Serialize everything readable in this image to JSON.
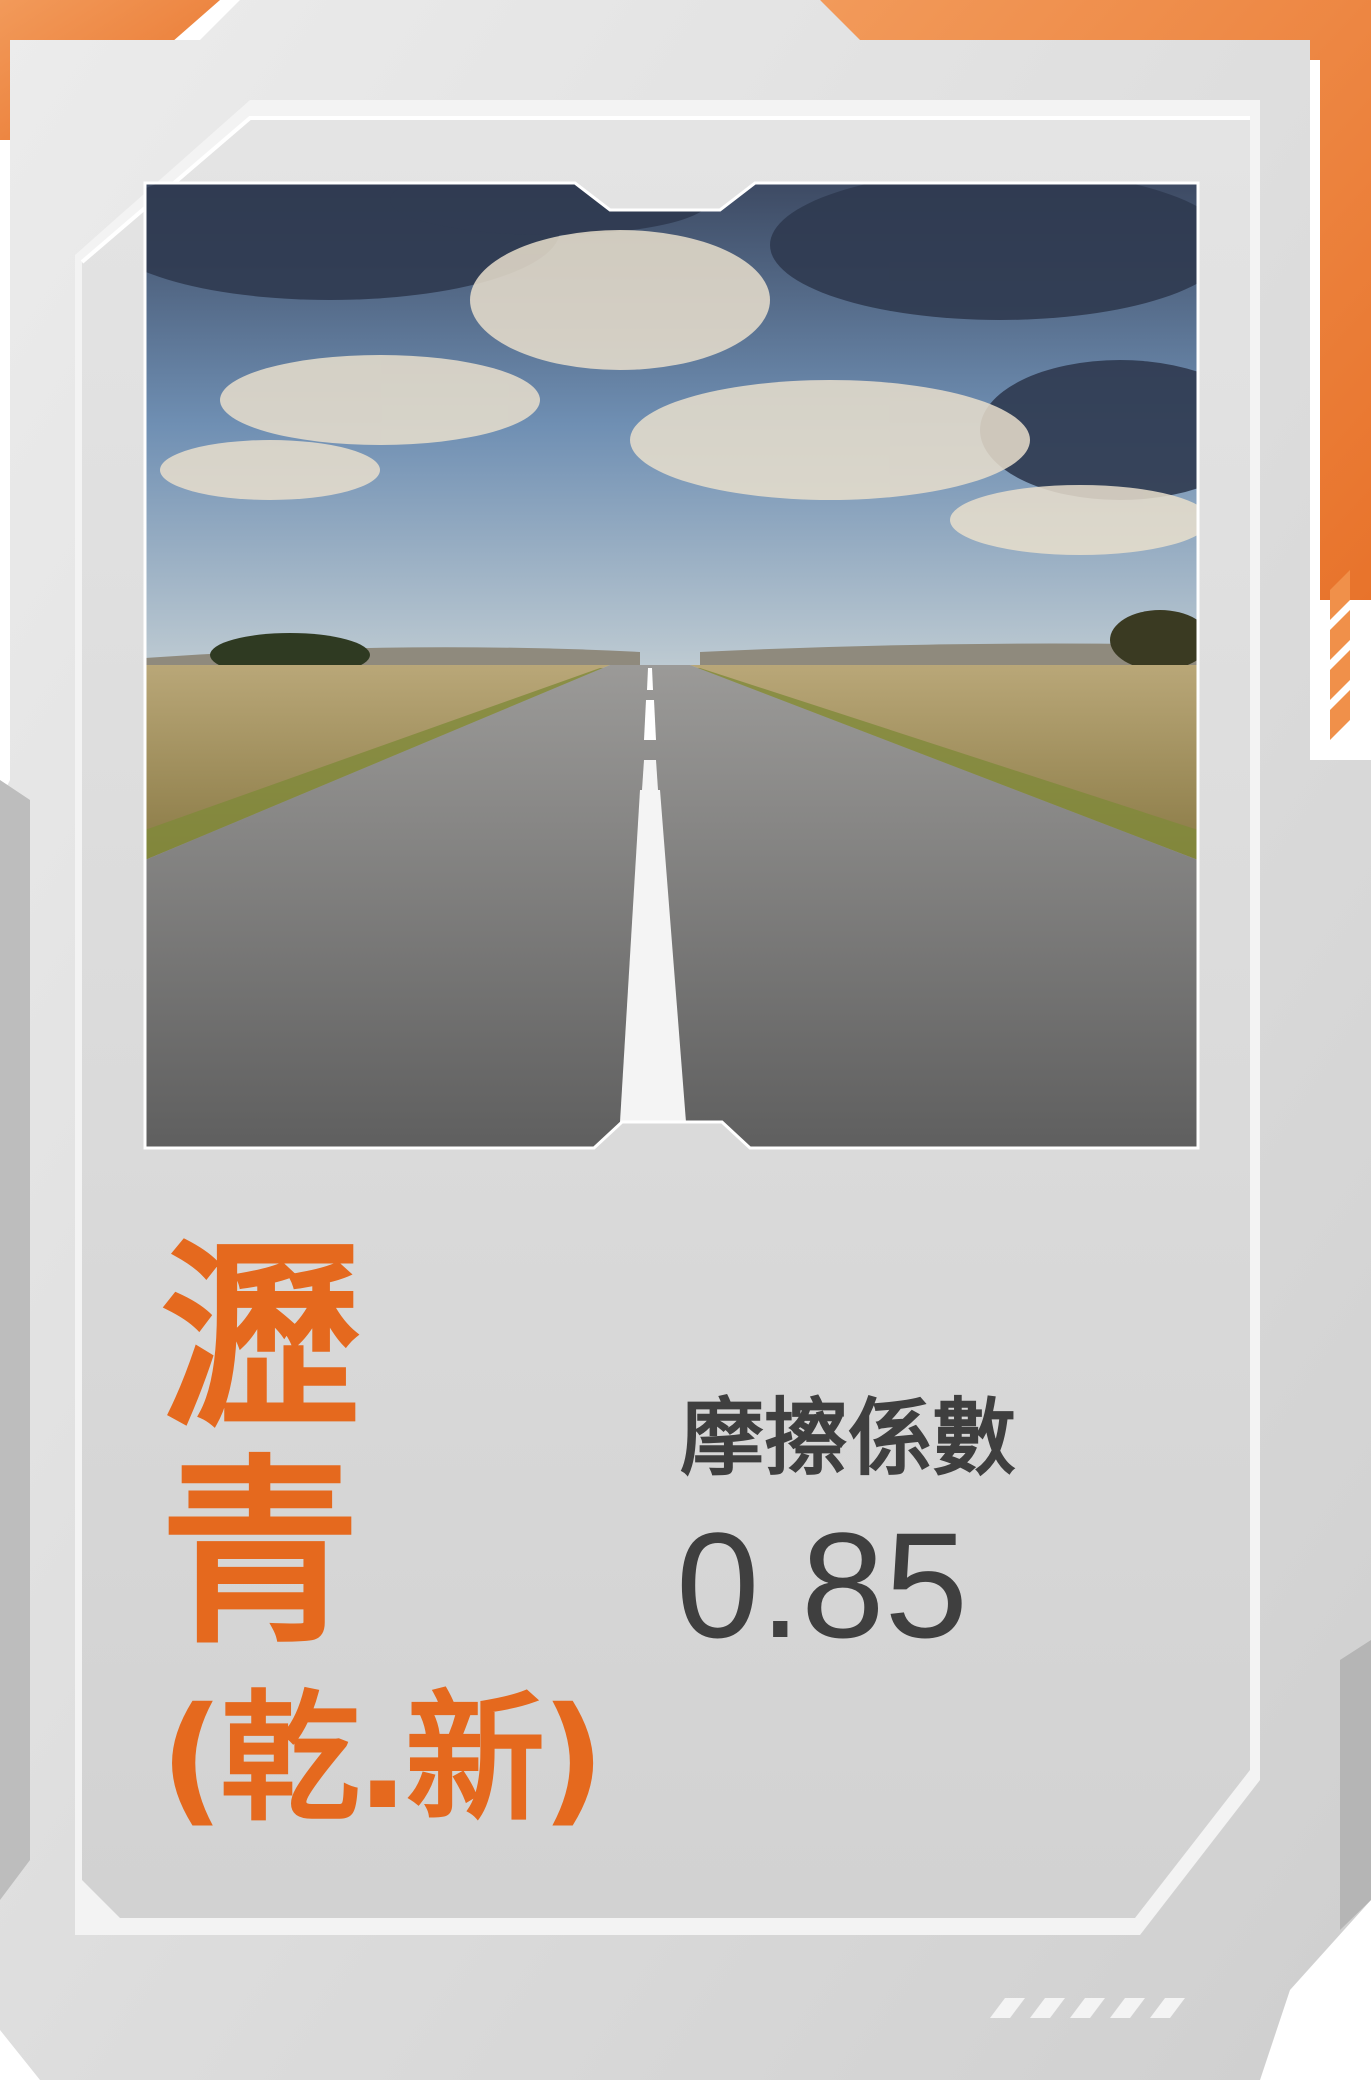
{
  "card": {
    "title_line1": "瀝",
    "title_line2": "青",
    "title_line3": "(乾.新)",
    "metric_label": "摩擦係數",
    "metric_value": "0.85"
  },
  "colors": {
    "accent": "#e5691e",
    "frame_outer": "#d9d9d9",
    "frame_inner": "#efefef",
    "panel": "#d8d8d8",
    "text_dark": "#3f3f3f"
  },
  "image": {
    "subject": "road-photo"
  }
}
